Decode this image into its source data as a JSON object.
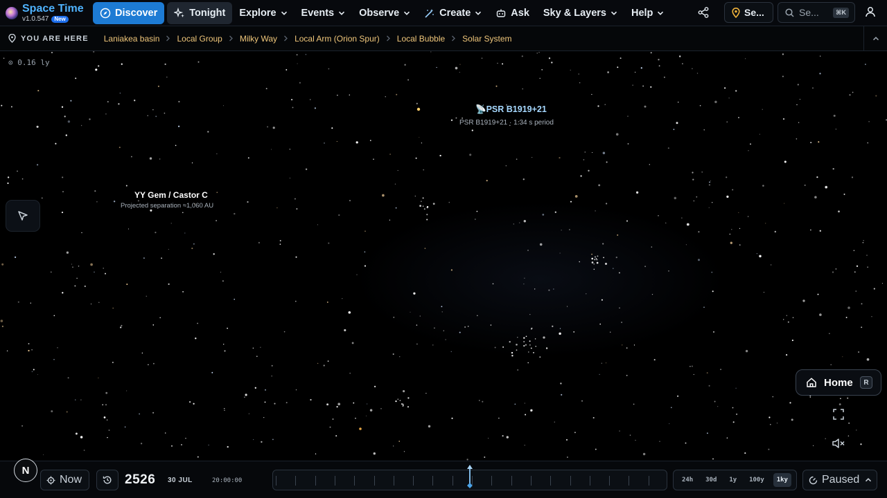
{
  "app": {
    "name": "Space Time",
    "version": "v1.0.547",
    "badge": "New"
  },
  "nav": {
    "discover": "Discover",
    "tonight": "Tonight",
    "explore": "Explore",
    "events": "Events",
    "observe": "Observe",
    "create": "Create",
    "ask": "Ask",
    "sky_layers": "Sky & Layers",
    "help": "Help",
    "location": "Se...",
    "search_placeholder": "Se...",
    "search_shortcut": "⌘K"
  },
  "breadcrumb": {
    "label": "YOU ARE HERE",
    "items": [
      "Laniakea basin",
      "Local Group",
      "Milky Way",
      "Local Arm (Orion Spur)",
      "Local Bubble",
      "Solar System"
    ]
  },
  "sky": {
    "scale": "0.16 ly",
    "labels": {
      "pulsar": {
        "title": "PSR B1919+21",
        "subtitle": "PSR B1919+21 · 1.34 s period"
      },
      "castor": {
        "title": "YY Gem / Castor C",
        "subtitle": "Projected separation ≈1,060 AU"
      }
    },
    "home": {
      "label": "Home",
      "shortcut": "R"
    }
  },
  "timeline": {
    "compass": "N",
    "now": "Now",
    "year": "2526",
    "date": "30 JUL",
    "time": "20:00:00",
    "ranges": [
      "24h",
      "30d",
      "1y",
      "100y",
      "1ky"
    ],
    "active_range": "1ky",
    "playback": "Paused"
  },
  "colors": {
    "accent": "#1d7bd4",
    "brand": "#4fb3ff",
    "crumb": "#f0c77b",
    "pulsar": "#a6d8ff"
  }
}
